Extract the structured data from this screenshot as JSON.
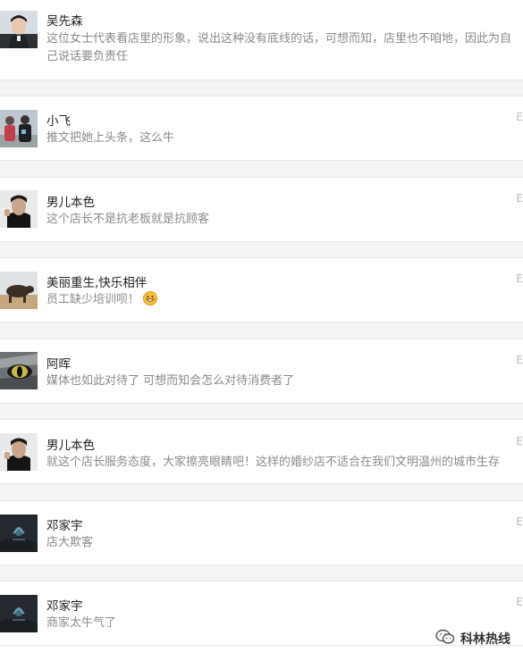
{
  "comments": [
    {
      "author": "吴先森",
      "text": "这位女士代表看店里的形象，说出这种没有底线的话，可想而知，店里也不咱地，因此为自己说话要负责任",
      "edge": "E",
      "avatar_icon": "man-portrait-icon"
    },
    {
      "author": "小飞",
      "text": "推文把她上头条，这么牛",
      "edge": "E",
      "avatar_icon": "couple-photo-icon"
    },
    {
      "author": "男儿本色",
      "text": "这个店长不是抗老板就是抗顾客",
      "edge": "E",
      "avatar_icon": "man-smoking-icon"
    },
    {
      "author": "美丽重生,快乐相伴",
      "text": "员工缺少培训呗！",
      "edge": "E",
      "avatar_icon": "buffalo-photo-icon",
      "emoji": "grinning-emoji-icon"
    },
    {
      "author": "阿晖",
      "text": "媒体也如此对待了 可想而知会怎么对待消费者了",
      "edge": "E",
      "avatar_icon": "wolf-eye-icon"
    },
    {
      "author": "男儿本色",
      "text": "就这个店长服务态度，大家擦亮眼睛吧！这样的婚纱店不适合在我们文明温州的城市生存",
      "edge": "E",
      "avatar_icon": "man-smoking-icon"
    },
    {
      "author": "邓家宇",
      "text": "店大欺客",
      "edge": "E",
      "avatar_icon": "dark-logo-icon"
    },
    {
      "author": "邓家宇",
      "text": "商家太牛气了",
      "edge": "E",
      "avatar_icon": "dark-logo-icon"
    }
  ],
  "watermark": {
    "text": "科林热线",
    "icon": "wechat-icon"
  },
  "colors": {
    "author": "#222222",
    "text": "#8a8a8a",
    "gap": "#f4f4f4",
    "divider": "#e6e6e6"
  }
}
